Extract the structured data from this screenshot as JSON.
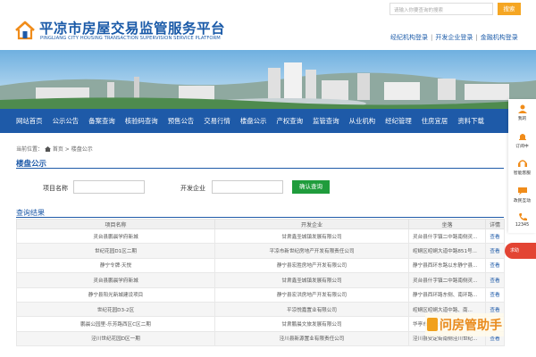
{
  "header": {
    "title_cn": "平凉市房屋交易监管服务平台",
    "title_en": "PINGLIANG CITY HOUSING TRANSACTION SUPERVISION SERVICE PLATFORM",
    "search_placeholder": "请输入你要查询的搜索",
    "search_label": "搜索",
    "top_links": [
      "经纪机构登录",
      "开发企业登录",
      "金融机构登录"
    ],
    "top_link_sep": "|"
  },
  "nav": {
    "items": [
      "网站首页",
      "公示公告",
      "备案查询",
      "核验码查询",
      "预售公告",
      "交易行情",
      "楼盘公示",
      "产权查询",
      "监管查询",
      "从业机构",
      "经纪管理",
      "住房宜居",
      "资料下载"
    ]
  },
  "breadcrumb": {
    "current_label": "当前位置：",
    "home": "首页",
    "sep": ">",
    "page": "楼盘公示"
  },
  "section": {
    "title": "楼盘公示"
  },
  "query_form": {
    "project_label": "项目名称",
    "project_value": "",
    "developer_label": "开发企业",
    "developer_value": "",
    "submit_label": "确认查询"
  },
  "results": {
    "title": "查询结果",
    "columns": [
      "项目名称",
      "开发企业",
      "坐落",
      "详情"
    ],
    "rows": [
      {
        "project": "灵台县鹏晨学府新城",
        "developer": "甘肃鑫圣城镇发展有限公司",
        "address": "灵台县什字镇二中路南侧灵...",
        "action": "查看"
      },
      {
        "project": "世纪花园D1区二期",
        "developer": "平凉市新世纪房地产开发有限责任公司",
        "address": "崆峒区崆峒大道中路851号...",
        "action": "查看"
      },
      {
        "project": "静宁令牌·天悦",
        "developer": "静宁县宏胜房地产开发有限公司",
        "address": "静宁县西环东路以东静宁县...",
        "action": "查看"
      },
      {
        "project": "灵台县鹏晨学府新城",
        "developer": "甘肃鑫圣城镇发展有限公司",
        "address": "灵台县什字镇二中路南侧灵...",
        "action": "查看"
      },
      {
        "project": "静宁县阳光新城建设项目",
        "developer": "静宁县宏洪房地产开发有限公司",
        "address": "静宁县西环路东侧、南环路...",
        "action": "查看"
      },
      {
        "project": "世纪花园D3-2区",
        "developer": "平凉悦嘉置业有限公司",
        "address": "崆峒区崆峒大道中路、南...",
        "action": "查看"
      },
      {
        "project": "鹏晨公园里-乐芳路西区C区二期",
        "developer": "甘肃鹏晨文旅发展有限公司",
        "address": "华亭市华亭火车站南侧城区...",
        "action": "查看"
      },
      {
        "project": "泾川世纪花园D区一期",
        "developer": "泾川县新源置业有限责任公司",
        "address": "泾川县安定街南侧泾川世纪...",
        "action": "查看"
      }
    ]
  },
  "sidebar": {
    "items": [
      "我的",
      "订阅中",
      "智能客服",
      "政民互动",
      "12345"
    ],
    "help_label": "求助"
  },
  "watermark": {
    "text": "问房管助手"
  },
  "colors": {
    "brand_blue": "#1e5aa8",
    "search_orange": "#f5a623",
    "query_green": "#1f9c3c",
    "help_red": "#e34433"
  }
}
